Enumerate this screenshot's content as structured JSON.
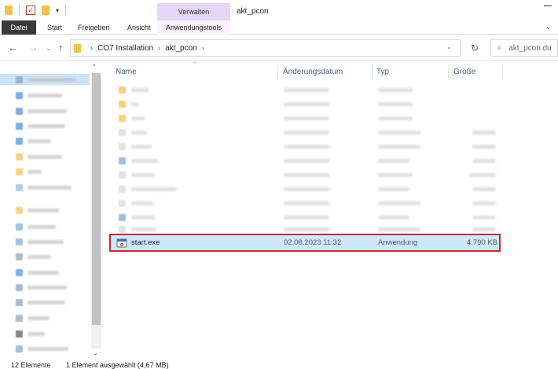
{
  "window": {
    "title": "akt_pcon",
    "context_group": "Verwalten"
  },
  "ribbon": {
    "tabs": [
      {
        "label": "Datei"
      },
      {
        "label": "Start"
      },
      {
        "label": "Freigeben"
      },
      {
        "label": "Ansicht"
      },
      {
        "label": "Anwendungstools"
      }
    ],
    "context_color": "#e6d6f5"
  },
  "address": {
    "breadcrumbs": [
      "CO7 Installation",
      "akt_pcon"
    ],
    "search_placeholder": "akt_pcon.du"
  },
  "columns": {
    "name": "Name",
    "date": "Änderungsdatum",
    "type": "Typ",
    "size": "Größe"
  },
  "selected_file": {
    "name": "start.exe",
    "date": "02.08.2023 11:32",
    "type": "Anwendung",
    "size": "4.790 KB",
    "icon": "exe-icon",
    "highlight_color": "#c8272e"
  },
  "status": {
    "count": "12 Elemente",
    "selection": "1 Element ausgewählt (4,67 MB)"
  },
  "icons": {
    "back": "arrow-left-icon",
    "forward": "arrow-right-icon",
    "up": "arrow-up-icon",
    "refresh": "refresh-icon",
    "search": "search-icon"
  }
}
